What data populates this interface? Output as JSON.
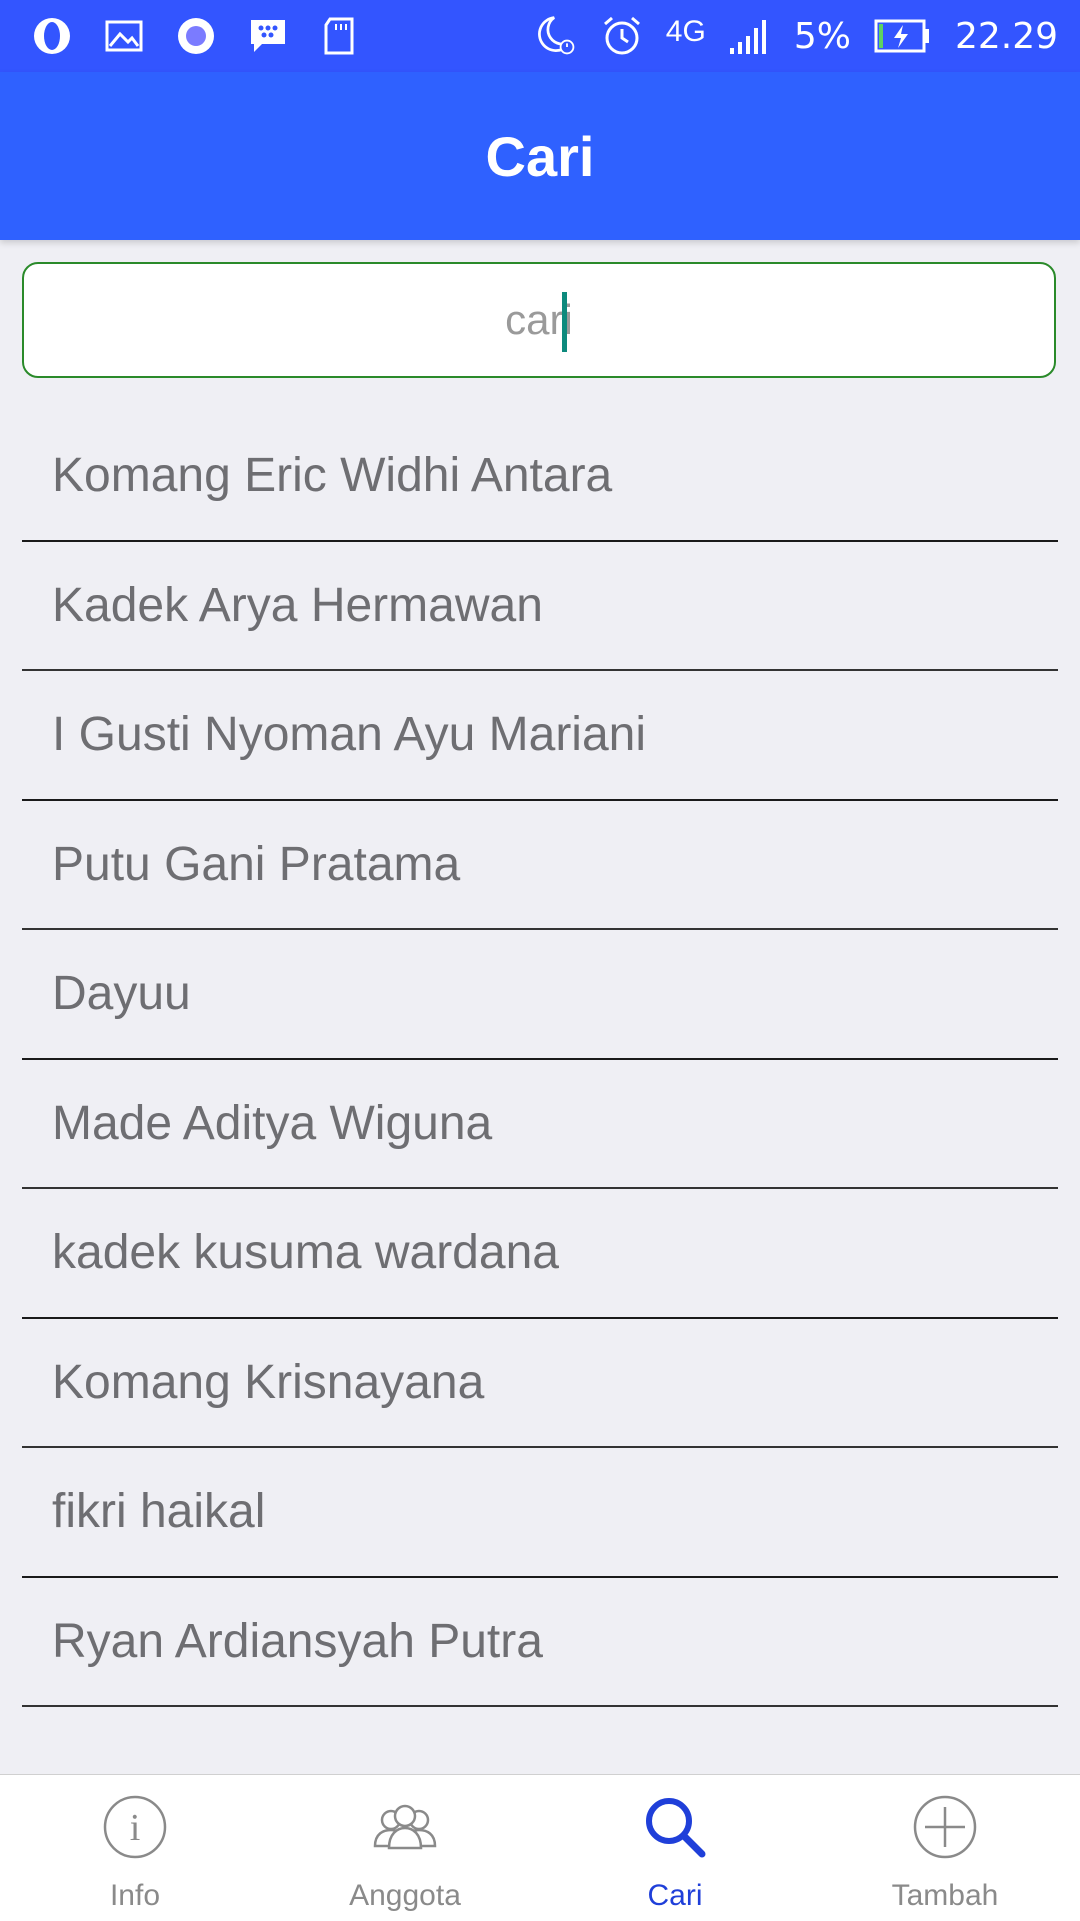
{
  "status_bar": {
    "network": "4G",
    "battery": "5%",
    "time": "22.29",
    "left_icons": [
      "opera-icon",
      "gallery-icon",
      "circle-app-icon",
      "bbm-icon",
      "sd-card-icon"
    ],
    "right_icons": [
      "night-mode-icon",
      "alarm-icon",
      "signal-icon",
      "battery-charging-icon"
    ]
  },
  "header": {
    "title": "Cari"
  },
  "search": {
    "placeholder": "cari",
    "value": ""
  },
  "members": [
    "Komang Eric Widhi Antara",
    "Kadek Arya Hermawan",
    "I Gusti Nyoman Ayu Mariani",
    "Putu Gani Pratama",
    "Dayuu",
    "Made Aditya Wiguna",
    "kadek kusuma wardana",
    "Komang Krisnayana",
    "fikri haikal",
    "Ryan Ardiansyah Putra"
  ],
  "tabs": [
    {
      "label": "Info",
      "icon": "info-icon",
      "active": false
    },
    {
      "label": "Anggota",
      "icon": "members-icon",
      "active": false
    },
    {
      "label": "Cari",
      "icon": "search-icon",
      "active": true
    },
    {
      "label": "Tambah",
      "icon": "add-icon",
      "active": false
    }
  ],
  "colors": {
    "status_bar": "#3355ff",
    "header": "#2f61ff",
    "active_tab": "#1f3fd9",
    "inactive_tab": "#8a8a8a",
    "search_border": "#2a8a2a"
  }
}
